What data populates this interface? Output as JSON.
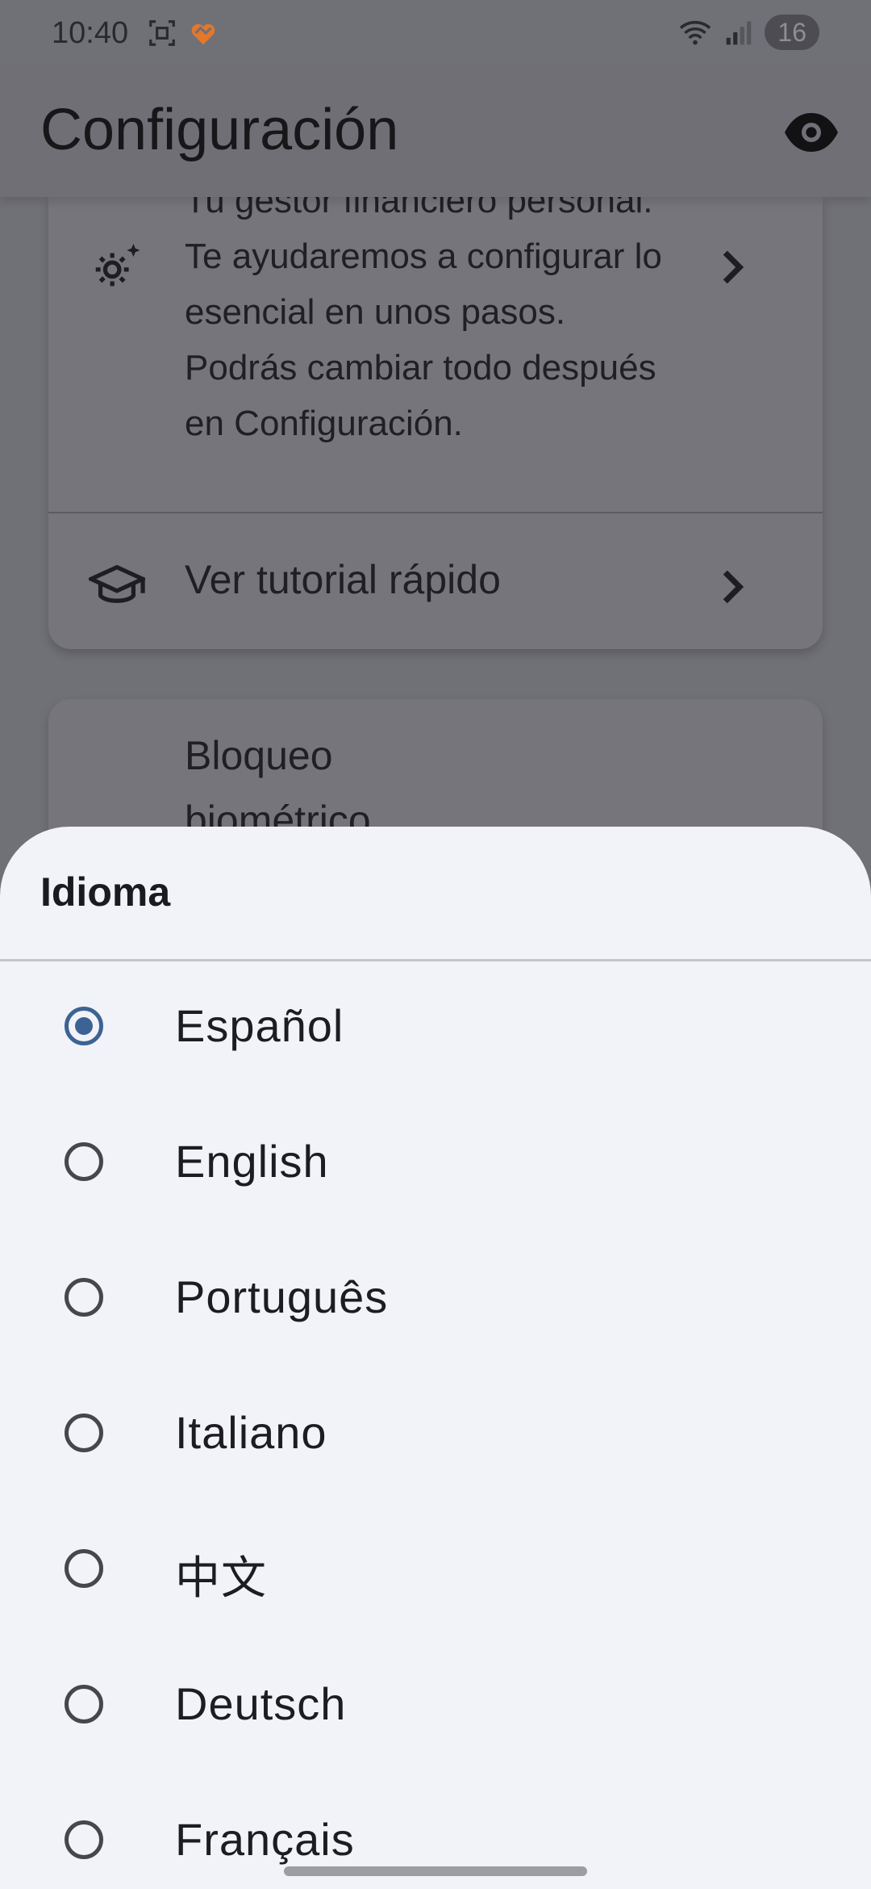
{
  "status_bar": {
    "time": "10:40",
    "battery": "16",
    "icons": [
      "screenshot-icon",
      "heart-app-icon",
      "wifi-icon",
      "signal-icon"
    ]
  },
  "app_bar": {
    "title": "Configuración",
    "action_icon": "eye-icon"
  },
  "background": {
    "welcome_partial": "Tu gestor financiero personal. Te ayudaremos a configurar lo esencial en unos pasos. Podrás cambiar todo después en Configuración.",
    "tutorial": "Ver tutorial rápido",
    "biometric": "Bloqueo biométrico"
  },
  "sheet": {
    "title": "Idioma",
    "selected": "Español",
    "options": [
      {
        "label": "Español",
        "selected": true
      },
      {
        "label": "English",
        "selected": false
      },
      {
        "label": "Português",
        "selected": false
      },
      {
        "label": "Italiano",
        "selected": false
      },
      {
        "label": "中文",
        "selected": false
      },
      {
        "label": "Deutsch",
        "selected": false
      },
      {
        "label": "Français",
        "selected": false
      }
    ]
  },
  "colors": {
    "accent": "#3c6393",
    "sheet_bg": "#f2f3f9",
    "scrim": "#707077"
  }
}
